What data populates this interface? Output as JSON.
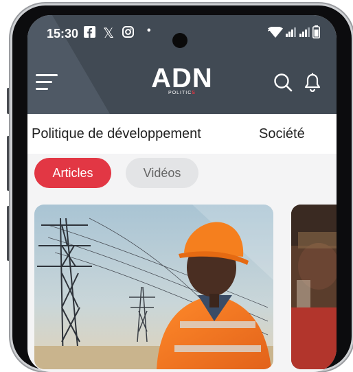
{
  "status_bar": {
    "time": "15:30",
    "notification_icons": [
      "facebook-icon",
      "x-icon",
      "instagram-icon",
      "dot-icon"
    ],
    "system_icons": [
      "wifi-icon",
      "signal-icon",
      "signal-icon",
      "battery-icon"
    ]
  },
  "header": {
    "logo_text": "ADN",
    "logo_sub": "POLITIC",
    "logo_sub_accent": "S",
    "colors": {
      "background": "#414a54",
      "accent": "#e23744"
    }
  },
  "categories": [
    {
      "label": "Politique de développement",
      "active": false
    },
    {
      "label": "Société",
      "active": false
    }
  ],
  "filters": [
    {
      "label": "Articles",
      "selected": true
    },
    {
      "label": "Vidéos",
      "selected": false
    }
  ]
}
